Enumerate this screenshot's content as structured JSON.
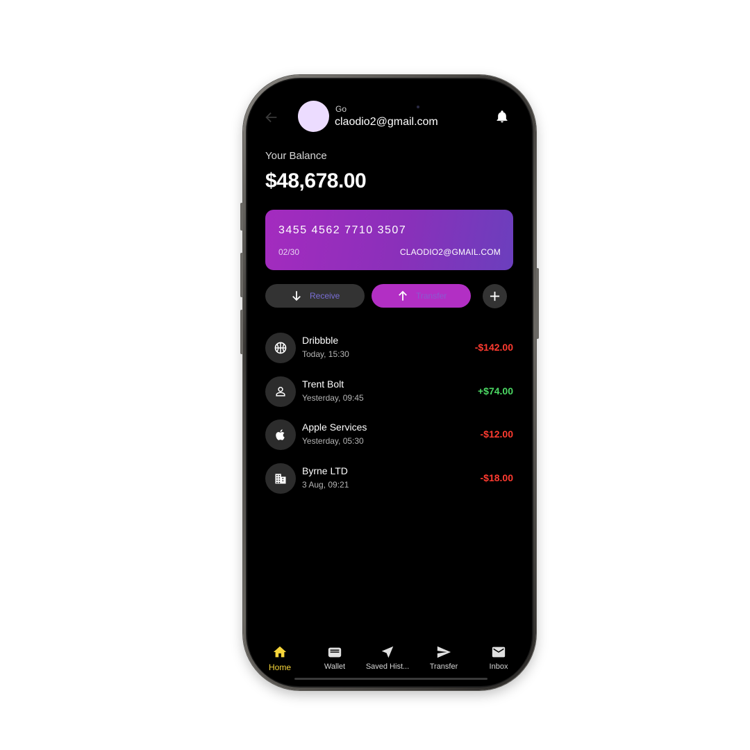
{
  "header": {
    "account_provider": "Go",
    "account_email": "claodio2@gmail.com"
  },
  "balance": {
    "label": "Your Balance",
    "value": "$48,678.00"
  },
  "card": {
    "number": "3455 4562 7710 3507",
    "expiry": "02/30",
    "holder": "CLAODIO2@GMAIL.COM"
  },
  "actions": {
    "receive_label": "Receive",
    "transfer_label": "Transfer"
  },
  "transactions": [
    {
      "name": "Dribbble",
      "time": "Today, 15:30",
      "amount": "-$142.00",
      "icon": "basketball-icon"
    },
    {
      "name": "Trent Bolt",
      "time": "Yesterday, 09:45",
      "amount": "+$74.00",
      "icon": "person-icon"
    },
    {
      "name": "Apple Services",
      "time": "Yesterday, 05:30",
      "amount": "-$12.00",
      "icon": "apple-icon"
    },
    {
      "name": "Byrne LTD",
      "time": "3 Aug, 09:21",
      "amount": "-$18.00",
      "icon": "building-icon"
    }
  ],
  "nav": [
    {
      "label": "Home",
      "icon": "home-icon",
      "active": true
    },
    {
      "label": "Wallet",
      "icon": "wallet-icon",
      "active": false
    },
    {
      "label": "Saved Hist...",
      "icon": "navigation-arrow-icon",
      "active": false
    },
    {
      "label": "Transfer",
      "icon": "send-icon",
      "active": false
    },
    {
      "label": "Inbox",
      "icon": "mail-icon",
      "active": false
    }
  ],
  "colors": {
    "accent": "#b22fc4",
    "card_gradient_start": "#a42bbf",
    "card_gradient_end": "#6b3fbd",
    "negative": "#ff3b30",
    "positive": "#4cd964",
    "nav_active": "#f6d53a"
  }
}
